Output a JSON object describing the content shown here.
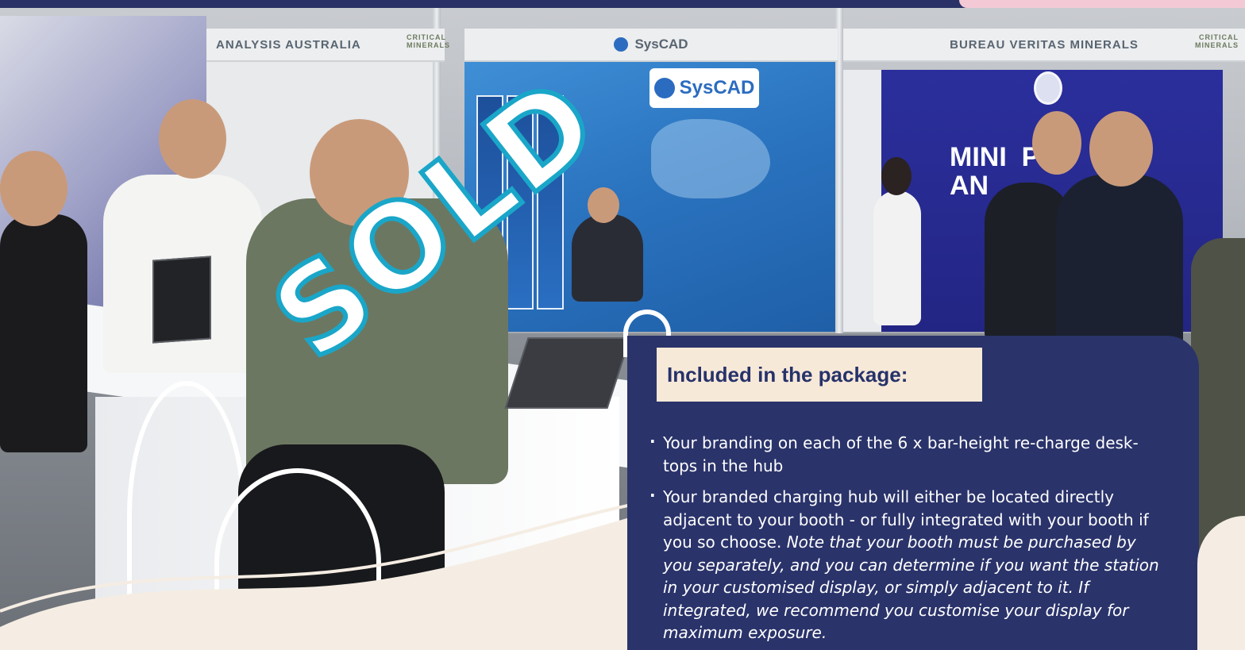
{
  "photo": {
    "booth_signs": {
      "left": "ANALYSIS AUSTRALIA",
      "left_tag": "CRITICAL MINERALS",
      "middle": "SysCAD",
      "right": "BUREAU VERITAS MINERALS",
      "right_tag": "CRITICAL MINERALS"
    },
    "syscad_panel": "SysCAD",
    "booth_right_text": "MINI  P\nAN"
  },
  "stamp": {
    "text": "SOLD"
  },
  "card": {
    "heading": "Included in the package:",
    "items": [
      {
        "text": "Your branding on each of the 6 x bar-height re-charge desk-tops in the hub",
        "note": ""
      },
      {
        "text": "Your branded charging hub will either be located directly adjacent to your booth - or fully integrated with your booth if you so choose. ",
        "note": "Note that your booth must be purchased by you separately, and you can determine if you want the station in your customised display, or simply adjacent to it. If integrated, we recommend you customise your display for maximum exposure."
      }
    ]
  },
  "colors": {
    "navy": "#2a336a",
    "cream": "#f7e9d8",
    "stamp_outline": "#1aa6c8"
  }
}
